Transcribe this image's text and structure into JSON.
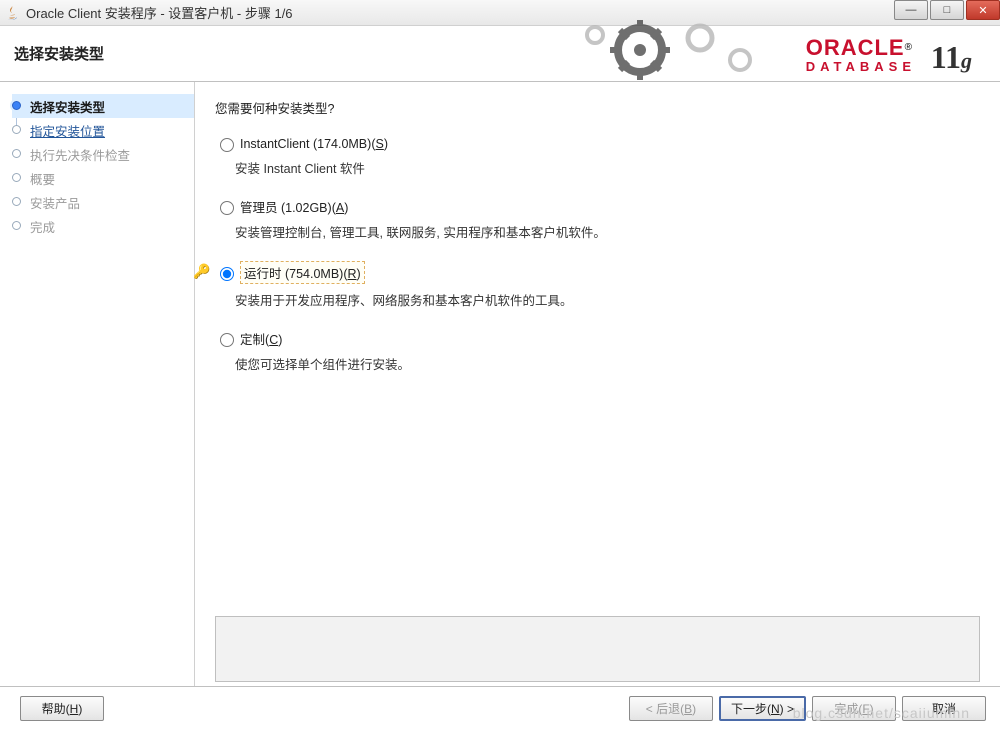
{
  "window": {
    "title": "Oracle Client 安装程序 - 设置客户机 - 步骤 1/6"
  },
  "header": {
    "title": "选择安装类型",
    "brand": "ORACLE",
    "brand_sub": "DATABASE",
    "version_main": "11",
    "version_suffix": "g"
  },
  "sidebar": {
    "steps": [
      {
        "label": "选择安装类型",
        "state": "current"
      },
      {
        "label": "指定安装位置",
        "state": "link"
      },
      {
        "label": "执行先决条件检查",
        "state": "disabled"
      },
      {
        "label": "概要",
        "state": "disabled"
      },
      {
        "label": "安装产品",
        "state": "disabled"
      },
      {
        "label": "完成",
        "state": "disabled"
      }
    ]
  },
  "main": {
    "prompt": "您需要何种安装类型?",
    "options": [
      {
        "label_main": "InstantClient (174.0MB)",
        "mnemonic": "S",
        "desc": "安装 Instant Client 软件",
        "selected": false
      },
      {
        "label_main": "管理员 (1.02GB)",
        "mnemonic": "A",
        "desc": "安装管理控制台, 管理工具, 联网服务, 实用程序和基本客户机软件。",
        "selected": false
      },
      {
        "label_main": "运行时 (754.0MB)",
        "mnemonic": "R",
        "desc": "安装用于开发应用程序、网络服务和基本客户机软件的工具。",
        "selected": true,
        "has_key_icon": true
      },
      {
        "label_main": "定制",
        "mnemonic": "C",
        "desc": "使您可选择单个组件进行安装。",
        "selected": false
      }
    ]
  },
  "footer": {
    "help": "帮助(",
    "help_mn": "H",
    "help_suffix": ")",
    "back": "< 后退(",
    "back_mn": "B",
    "back_suffix": ")",
    "next": "下一步(",
    "next_mn": "N",
    "next_suffix": ") >",
    "finish": "完成(",
    "finish_mn": "F",
    "finish_suffix": ")",
    "cancel": "取消"
  },
  "watermark": "blog.csdn.net/scaiiuminn"
}
